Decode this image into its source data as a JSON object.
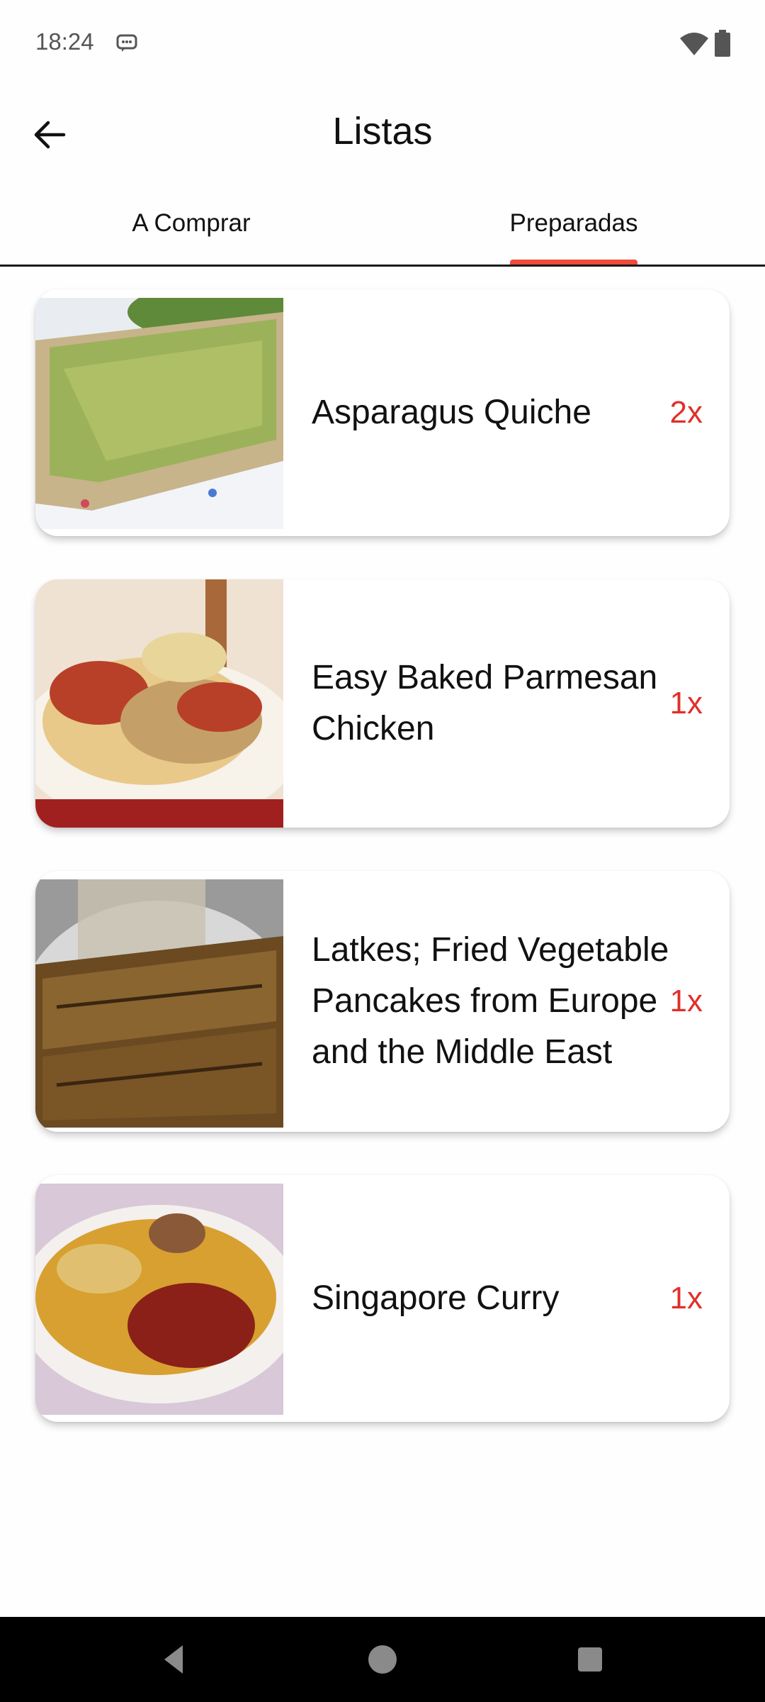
{
  "status_bar": {
    "time": "18:24"
  },
  "app_bar": {
    "title": "Listas"
  },
  "tabs": [
    {
      "label": "A Comprar",
      "selected": false
    },
    {
      "label": "Preparadas",
      "selected": true
    }
  ],
  "accent_color": "#f04a3c",
  "count_color": "#e0302a",
  "recipes": [
    {
      "title": "Asparagus Quiche",
      "count": "2x",
      "image": "quiche-photo"
    },
    {
      "title": "Easy Baked Parmesan Chicken",
      "count": "1x",
      "image": "parmesan-chicken-photo"
    },
    {
      "title": "Latkes; Fried Vegetable Pancakes from Europe and the Middle East",
      "count": "1x",
      "image": "latkes-photo"
    },
    {
      "title": "Singapore Curry",
      "count": "1x",
      "image": "singapore-curry-photo"
    }
  ],
  "nav_bar": {
    "buttons": [
      "back-triangle-icon",
      "home-circle-icon",
      "recents-square-icon"
    ]
  }
}
